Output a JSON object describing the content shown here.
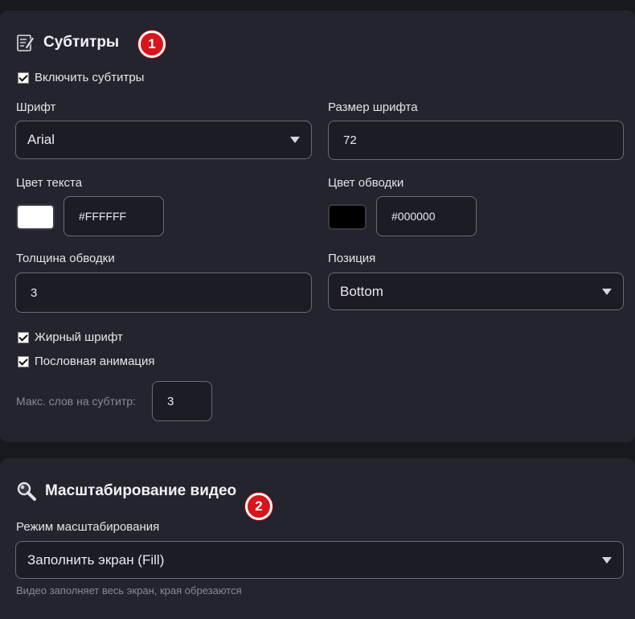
{
  "subtitles": {
    "title": "Субтитры",
    "icon": "memo-icon",
    "badge": "1",
    "enable_label": "Включить субтитры",
    "enable_checked": true,
    "font_label": "Шрифт",
    "font_value": "Arial",
    "font_size_label": "Размер шрифта",
    "font_size_value": "72",
    "text_color_label": "Цвет текста",
    "text_color_value": "#FFFFFF",
    "text_color_swatch": "#ffffff",
    "stroke_color_label": "Цвет обводки",
    "stroke_color_value": "#000000",
    "stroke_color_swatch": "#000000",
    "stroke_width_label": "Толщина обводки",
    "stroke_width_value": "3",
    "position_label": "Позиция",
    "position_value": "Bottom",
    "bold_label": "Жирный шрифт",
    "bold_checked": true,
    "word_anim_label": "Пословная анимация",
    "word_anim_checked": true,
    "max_words_label": "Макс. слов на субтитр:",
    "max_words_value": "3"
  },
  "scaling": {
    "title": "Масштабирование видео",
    "icon": "magnifier-icon",
    "badge": "2",
    "mode_label": "Режим масштабирования",
    "mode_value": "Заполнить экран (Fill)",
    "mode_hint": "Видео заполняет весь экран, края обрезаются"
  },
  "colors": {
    "badge": "#d8141c",
    "panel": "#24242f",
    "background": "#18181f"
  }
}
